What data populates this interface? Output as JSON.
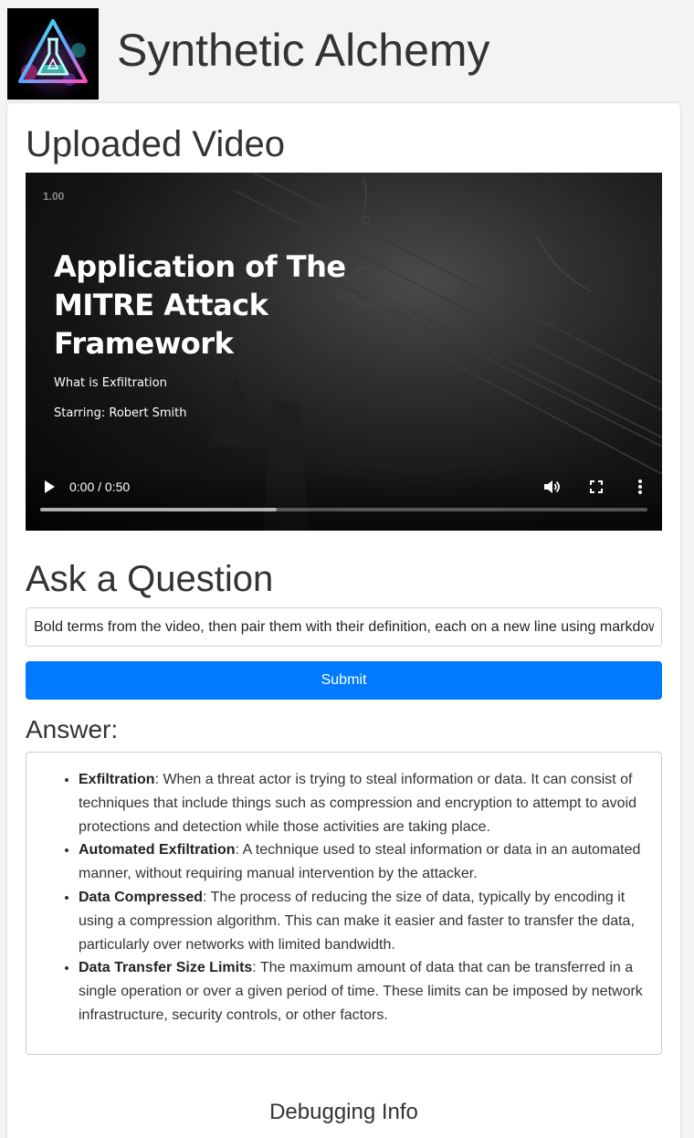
{
  "app": {
    "title": "Synthetic Alchemy",
    "logo_icon": "flask-triangle-logo-icon"
  },
  "video_section": {
    "heading": "Uploaded Video",
    "playback_rate": "1.00",
    "slide": {
      "title": "Application of The MITRE Attack Framework",
      "subtitle": "What is Exfiltration",
      "starring": "Starring: Robert Smith"
    },
    "controls": {
      "time": "0:00 / 0:50",
      "buffered_fraction": 0.39,
      "play_icon": "play-icon",
      "volume_icon": "volume-icon",
      "fullscreen_icon": "fullscreen-icon",
      "more_icon": "more-vertical-icon"
    }
  },
  "question_section": {
    "heading": "Ask a Question",
    "input_value": "Bold terms from the video, then pair them with their definition, each on a new line using markdown",
    "submit_label": "Submit",
    "accent_color": "#007bff"
  },
  "answer_section": {
    "heading": "Answer:",
    "items": [
      {
        "term": "Exfiltration",
        "definition": ": When a threat actor is trying to steal information or data. It can consist of techniques that include things such as compression and encryption to attempt to avoid protections and detection while those activities are taking place."
      },
      {
        "term": "Automated Exfiltration",
        "definition": ": A technique used to steal information or data in an automated manner, without requiring manual intervention by the attacker."
      },
      {
        "term": "Data Compressed",
        "definition": ": The process of reducing the size of data, typically by encoding it using a compression algorithm. This can make it easier and faster to transfer the data, particularly over networks with limited bandwidth."
      },
      {
        "term": "Data Transfer Size Limits",
        "definition": ": The maximum amount of data that can be transferred in a single operation or over a given period of time. These limits can be imposed by network infrastructure, security controls, or other factors."
      }
    ]
  },
  "debug": {
    "heading": "Debugging Info"
  }
}
